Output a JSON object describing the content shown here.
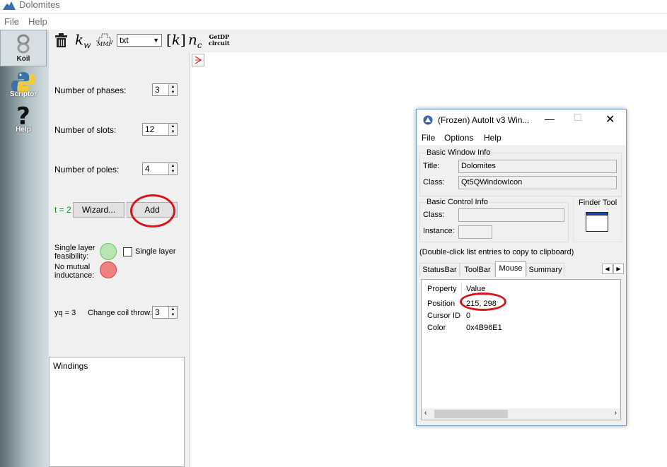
{
  "app": {
    "title": "Dolomites"
  },
  "menubar": {
    "items": [
      "File",
      "Help"
    ]
  },
  "sidebar": {
    "items": [
      {
        "label": "Koil"
      },
      {
        "label": "Scriptor"
      },
      {
        "label": "Help"
      }
    ]
  },
  "toolbar": {
    "file_type": "txt",
    "getdp_label_1": "GetDP",
    "getdp_label_2": "circuit",
    "mmf_label": "MMF"
  },
  "panel": {
    "phases_label": "Number of phases:",
    "phases_value": "3",
    "slots_label": "Number of slots:",
    "slots_value": "12",
    "poles_label": "Number of poles:",
    "poles_value": "4",
    "t_label": "t = 2",
    "wizard_label": "Wizard...",
    "add_label": "Add",
    "single_layer_feas_1": "Single layer",
    "single_layer_feas_2": "feasibility:",
    "no_mutual_1": "No mutual",
    "no_mutual_2": "inductance:",
    "single_layer_checkbox": "Single layer",
    "yq_label": "yq = 3",
    "coil_throw_label": "Change coil throw:",
    "coil_throw_value": "3",
    "windings_label": "Windings",
    "feasible_color": "#b8e6b0",
    "mutual_color": "#f08080"
  },
  "autoit": {
    "title": "(Frozen) AutoIt v3 Win...",
    "menu": [
      "File",
      "Options",
      "Help"
    ],
    "basic_window_info": "Basic Window Info",
    "title_label": "Title:",
    "title_value": "Dolomites",
    "class_label": "Class:",
    "class_value": "Qt5QWindowIcon",
    "basic_control_info": "Basic Control Info",
    "ctrl_class_label": "Class:",
    "instance_label": "Instance:",
    "finder_tool": "Finder Tool",
    "dblclick_hint": "(Double-click list entries to copy to clipboard)",
    "tabs": [
      "StatusBar",
      "ToolBar",
      "Mouse",
      "Summary"
    ],
    "active_tab": "Mouse",
    "list_headers": [
      "Property",
      "Value"
    ],
    "rows": [
      {
        "property": "Position",
        "value": "215, 298"
      },
      {
        "property": "Cursor ID",
        "value": "0"
      },
      {
        "property": "Color",
        "value": "0x4B96E1"
      }
    ]
  },
  "annotation_color": "#d8141a"
}
